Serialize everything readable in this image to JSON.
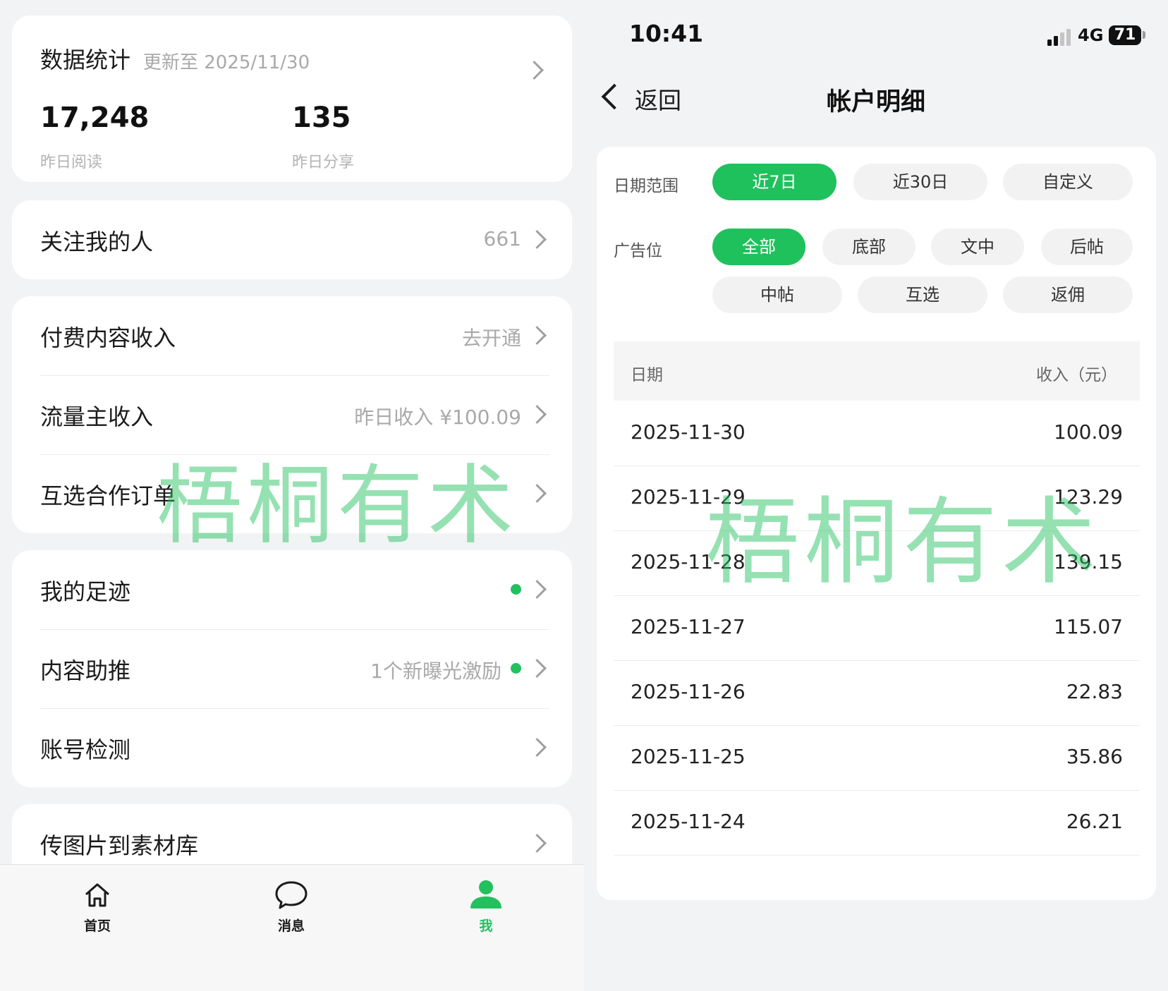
{
  "left": {
    "stats": {
      "title": "数据统计",
      "updated": "更新至 2025/11/30",
      "metrics": [
        {
          "value": "17,248",
          "label": "昨日阅读"
        },
        {
          "value": "135",
          "label": "昨日分享"
        }
      ]
    },
    "followers": {
      "label": "关注我的人",
      "value": "661"
    },
    "income_group": [
      {
        "label": "付费内容收入",
        "value": "去开通"
      },
      {
        "label": "流量主收入",
        "value": "昨日收入 ¥100.09"
      },
      {
        "label": "互选合作订单",
        "value": ""
      }
    ],
    "tools_group": [
      {
        "label": "我的足迹",
        "value": ""
      },
      {
        "label": "内容助推",
        "value": "1个新曝光激励"
      },
      {
        "label": "账号检测",
        "value": ""
      }
    ],
    "upload": {
      "label": "传图片到素材库"
    },
    "tabbar": [
      {
        "label": "首页",
        "icon": "home-icon"
      },
      {
        "label": "消息",
        "icon": "message-icon"
      },
      {
        "label": "我",
        "icon": "user-icon",
        "active": true
      }
    ],
    "watermark": "梧桐有术"
  },
  "right": {
    "status": {
      "time": "10:41",
      "network": "4G",
      "battery": "71"
    },
    "nav": {
      "back": "返回",
      "title": "帐户明细"
    },
    "filters": {
      "date_label": "日期范围",
      "date_options": [
        "近7日",
        "近30日",
        "自定义"
      ],
      "date_selected": "近7日",
      "ad_label": "广告位",
      "ad_options": [
        "全部",
        "底部",
        "文中",
        "后帖",
        "中帖",
        "互选",
        "返佣"
      ],
      "ad_selected": "全部"
    },
    "table": {
      "columns": [
        "日期",
        "收入（元）"
      ],
      "rows": [
        {
          "date": "2025-11-30",
          "amount": "100.09"
        },
        {
          "date": "2025-11-29",
          "amount": "123.29"
        },
        {
          "date": "2025-11-28",
          "amount": "139.15"
        },
        {
          "date": "2025-11-27",
          "amount": "115.07"
        },
        {
          "date": "2025-11-26",
          "amount": "22.83"
        },
        {
          "date": "2025-11-25",
          "amount": "35.86"
        },
        {
          "date": "2025-11-24",
          "amount": "26.21"
        }
      ]
    },
    "watermark": "梧桐有术"
  },
  "colors": {
    "accent": "#1fc15c",
    "muted": "#a9a9a9",
    "background": "#f2f3f5"
  }
}
